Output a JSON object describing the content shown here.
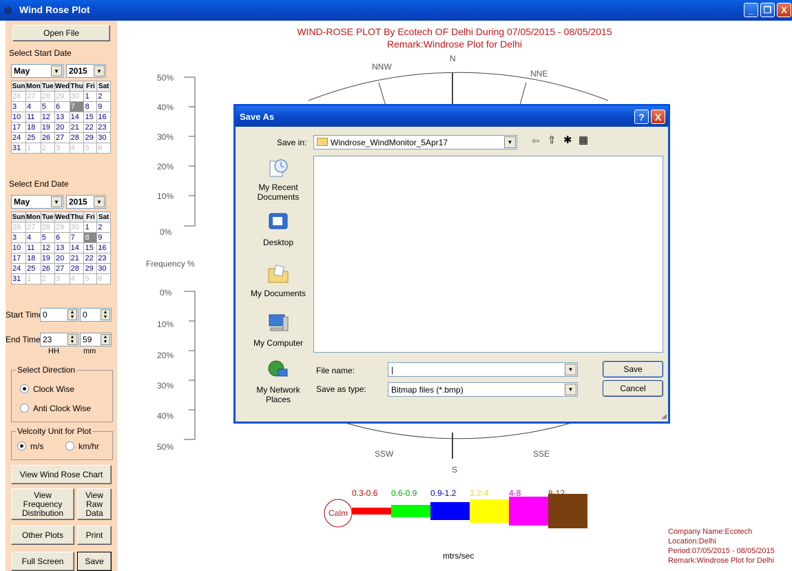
{
  "window": {
    "title": "Wind Rose Plot",
    "minimize": "_",
    "restore": "❐",
    "close": "X"
  },
  "left": {
    "open_file": "Open File",
    "start_date_label": "Select Start Date",
    "end_date_label": "Select End Date",
    "start_month": "May",
    "start_year": "2015",
    "end_month": "May",
    "end_year": "2015",
    "weekdays": [
      "Sun",
      "Mon",
      "Tue",
      "Wed",
      "Thu",
      "Fri",
      "Sat"
    ],
    "start_time_label": "Start Time",
    "start_hh": "0",
    "start_mm": "0",
    "end_time_label": "End Time",
    "end_hh": "23",
    "end_mm": "59",
    "hh": "HH",
    "mm": "mm",
    "direction_title": "Select Direction",
    "clockwise": "Clock Wise",
    "anticlockwise": "Anti Clock Wise",
    "velocity_title": "Velcoity Unit for Plot",
    "ms": "m/s",
    "kmhr": "km/hr",
    "view_chart": "View Wind Rose Chart",
    "view_freq": "View Frequency Distribution",
    "view_raw": "View Raw Data",
    "other_plots": "Other Plots",
    "print": "Print",
    "full_screen": "Full Screen",
    "save": "Save"
  },
  "chart": {
    "title": "WIND-ROSE PLOT By Ecotech OF Delhi During 07/05/2015 - 08/05/2015",
    "remark": "Remark:Windrose Plot for Delhi",
    "ylabel": "Frequency %",
    "directions": {
      "n": "N",
      "nnw": "NNW",
      "nne": "NNE",
      "s": "S",
      "ssw": "SSW",
      "sse": "SSE"
    },
    "upper_ticks": [
      "50%",
      "40%",
      "30%",
      "20%",
      "10%",
      "0%"
    ],
    "lower_ticks": [
      "0%",
      "10%",
      "20%",
      "30%",
      "40%",
      "50%"
    ],
    "calm": "Calm",
    "units": "mtrs/sec",
    "legend": [
      {
        "label": "0.3-0.6",
        "color": "#ff0000",
        "text_color": "#cc0000"
      },
      {
        "label": "0.6-0.9",
        "color": "#00ff00",
        "text_color": "#00aa00"
      },
      {
        "label": "0.9-1.2",
        "color": "#0000ff",
        "text_color": "#0000cc"
      },
      {
        "label": "1.2-4",
        "color": "#ffff00",
        "text_color": "#e6e600"
      },
      {
        "label": "4-8",
        "color": "#ff00ff",
        "text_color": "#cc00cc"
      },
      {
        "label": "8-12",
        "color": "#7a3f0f",
        "text_color": "#7a3f0f"
      }
    ]
  },
  "info": {
    "company": "Company Name:Ecotech",
    "location": "Location:Delhi",
    "period": "Period:07/05/2015 - 08/05/2015",
    "remark": "Remark:Windrose Plot for Delhi"
  },
  "dialog": {
    "title": "Save As",
    "help": "?",
    "close": "X",
    "save_in_label": "Save in:",
    "save_in_value": "Windrose_WindMonitor_5Apr17",
    "places": [
      "My Recent Documents",
      "Desktop",
      "My Documents",
      "My Computer",
      "My Network Places"
    ],
    "file_name_label": "File name:",
    "file_name_value": "|",
    "save_type_label": "Save as type:",
    "save_type_value": "Bitmap files (*.bmp)",
    "save_button": "Save",
    "cancel_button": "Cancel"
  }
}
